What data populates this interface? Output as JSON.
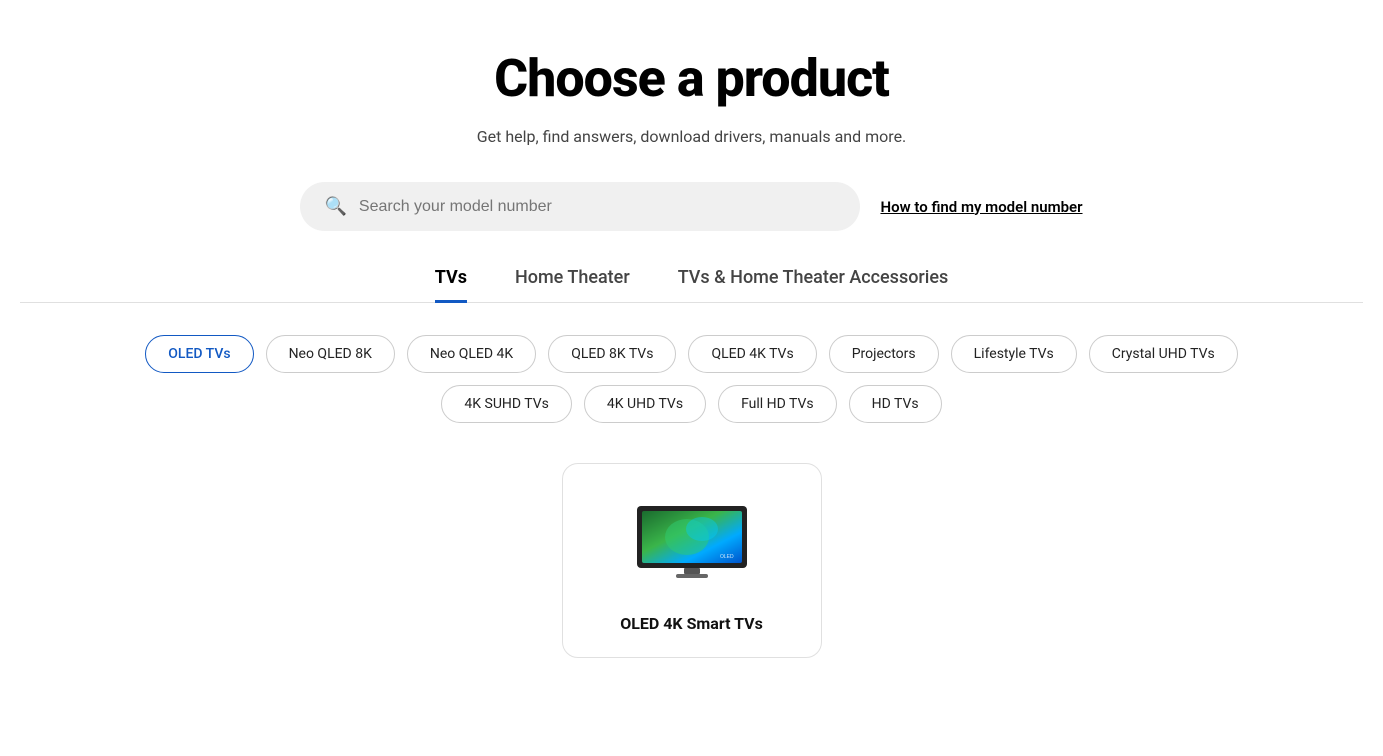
{
  "page": {
    "title": "Choose a product",
    "subtitle": "Get help, find answers, download drivers, manuals and more."
  },
  "search": {
    "placeholder": "Search your model number",
    "model_number_link": "How to find my model number"
  },
  "tabs": [
    {
      "id": "tvs",
      "label": "TVs",
      "active": true
    },
    {
      "id": "home-theater",
      "label": "Home Theater",
      "active": false
    },
    {
      "id": "accessories",
      "label": "TVs & Home Theater Accessories",
      "active": false
    }
  ],
  "chips": [
    {
      "id": "oled-tvs",
      "label": "OLED TVs",
      "selected": true
    },
    {
      "id": "neo-qled-8k",
      "label": "Neo QLED 8K",
      "selected": false
    },
    {
      "id": "neo-qled-4k",
      "label": "Neo QLED 4K",
      "selected": false
    },
    {
      "id": "qled-8k-tvs",
      "label": "QLED 8K TVs",
      "selected": false
    },
    {
      "id": "qled-4k-tvs",
      "label": "QLED 4K TVs",
      "selected": false
    },
    {
      "id": "projectors",
      "label": "Projectors",
      "selected": false
    },
    {
      "id": "lifestyle-tvs",
      "label": "Lifestyle TVs",
      "selected": false
    },
    {
      "id": "crystal-uhd-tvs",
      "label": "Crystal UHD TVs",
      "selected": false
    },
    {
      "id": "4k-suhd-tvs",
      "label": "4K SUHD TVs",
      "selected": false
    },
    {
      "id": "4k-uhd-tvs",
      "label": "4K UHD TVs",
      "selected": false
    },
    {
      "id": "full-hd-tvs",
      "label": "Full HD TVs",
      "selected": false
    },
    {
      "id": "hd-tvs",
      "label": "HD TVs",
      "selected": false
    }
  ],
  "products": [
    {
      "id": "oled-4k-smart-tvs",
      "name": "OLED 4K Smart TVs"
    }
  ],
  "colors": {
    "active_tab_underline": "#1259c3",
    "selected_chip_border": "#1259c3",
    "selected_chip_text": "#1259c3"
  }
}
